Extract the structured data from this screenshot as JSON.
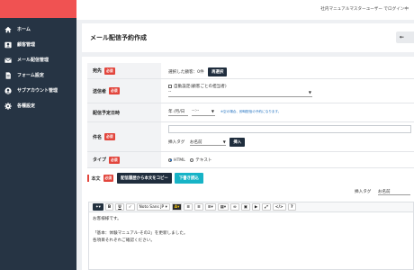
{
  "sidebar": {
    "items": [
      {
        "label": "ホーム",
        "icon": "home-icon"
      },
      {
        "label": "顧客管理",
        "icon": "user-icon"
      },
      {
        "label": "メール配信管理",
        "icon": "mail-icon"
      },
      {
        "label": "フォーム設定",
        "icon": "document-icon"
      },
      {
        "label": "サブアカウント管理",
        "icon": "account-icon"
      },
      {
        "label": "各種設定",
        "icon": "gear-icon"
      }
    ]
  },
  "header": {
    "login_text": "社内マニュアルマスターユーザー でログイン中"
  },
  "page": {
    "title": "メール配信予約作成",
    "back_label": "←"
  },
  "form": {
    "required_badge": "必須",
    "recipient": {
      "label": "宛先",
      "text": "選択した顧客：0件",
      "button": "再選択"
    },
    "sender": {
      "label": "送信者",
      "checkbox_label": "自動設定(顧客ごとの担当者)",
      "select_value": "--"
    },
    "schedule": {
      "label": "配信予定日時",
      "date_value": "年 /月/日",
      "time_value": "--:--",
      "note": "※空の場合、即時配信の予約になります。"
    },
    "subject": {
      "label": "件名",
      "insert_tag_label": "挿入タグ",
      "insert_tag_value": "お名前",
      "insert_button": "挿入"
    },
    "type": {
      "label": "タイプ",
      "option_html": "HTML",
      "option_text": "テキスト"
    },
    "body": {
      "label": "本文",
      "copy_button": "配信履歴から本文をコピー",
      "draft_button": "下書き読込",
      "insert_tag_label": "挿入タグ",
      "insert_tag_value": "お名前"
    }
  },
  "editor": {
    "toolbar": {
      "font_name": "Noto Sans JP"
    },
    "lines": [
      "お客様様です。",
      "",
      "「基本：体験マニュアル-その2」を更新しました。",
      "各項目それぞれご確認ください。"
    ]
  },
  "colors": {
    "sidebar_bg": "#263444",
    "brand_red": "#f05252",
    "teal_button": "#17b3c6",
    "dark_button": "#1f2d3d",
    "required_badge": "#e2453c"
  }
}
